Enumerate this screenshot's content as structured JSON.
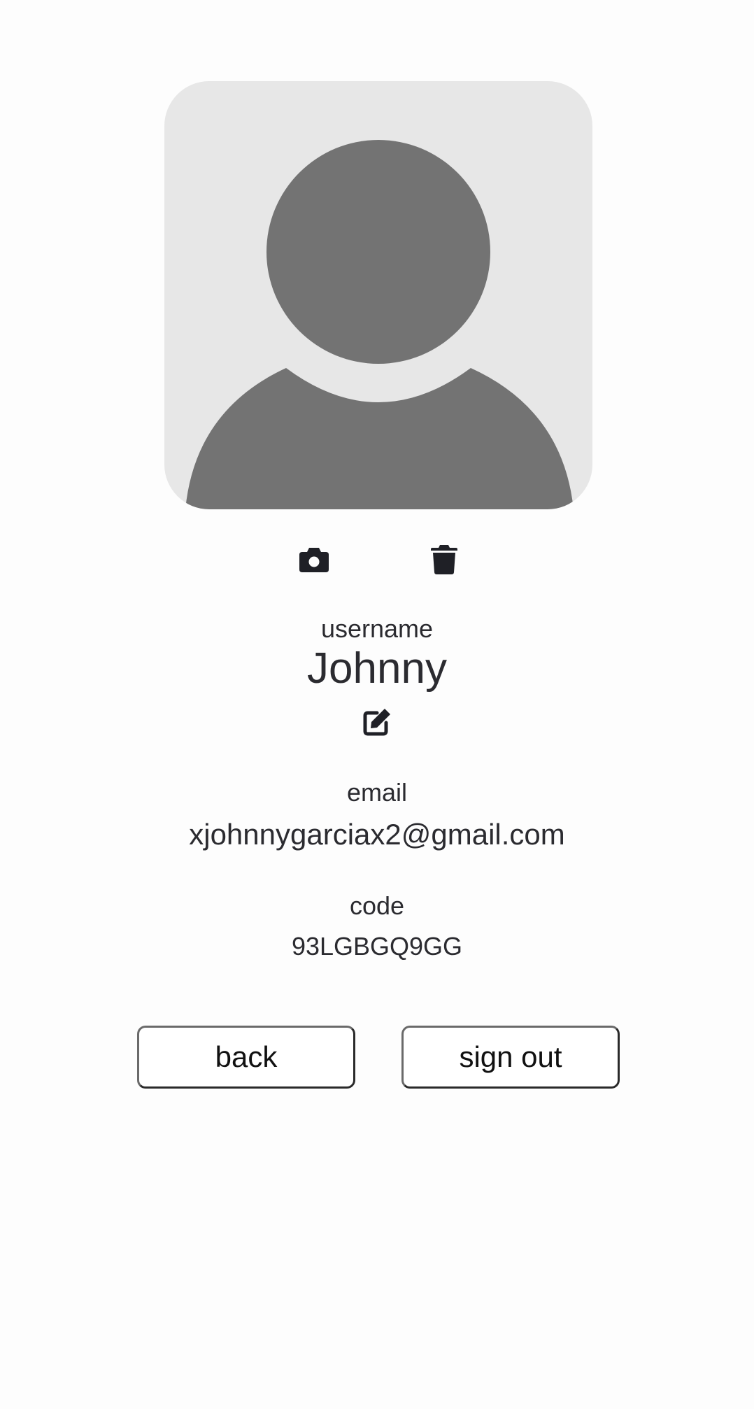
{
  "profile": {
    "avatar": {
      "icon": "default-user-silhouette",
      "background_color": "#e7e7e7",
      "figure_color": "#737373"
    },
    "photo_actions": {
      "camera_icon": "camera-icon",
      "delete_icon": "trash-icon"
    },
    "username": {
      "label": "username",
      "value": "Johnny",
      "edit_icon": "edit-icon"
    },
    "email": {
      "label": "email",
      "value": "xjohnnygarciax2@gmail.com"
    },
    "code": {
      "label": "code",
      "value": "93LGBGQ9GG"
    }
  },
  "actions": {
    "back_label": "back",
    "sign_out_label": "sign out"
  },
  "colors": {
    "text": "#2b2b30",
    "icon": "#1f2026",
    "page_background": "#fdfdfd"
  }
}
